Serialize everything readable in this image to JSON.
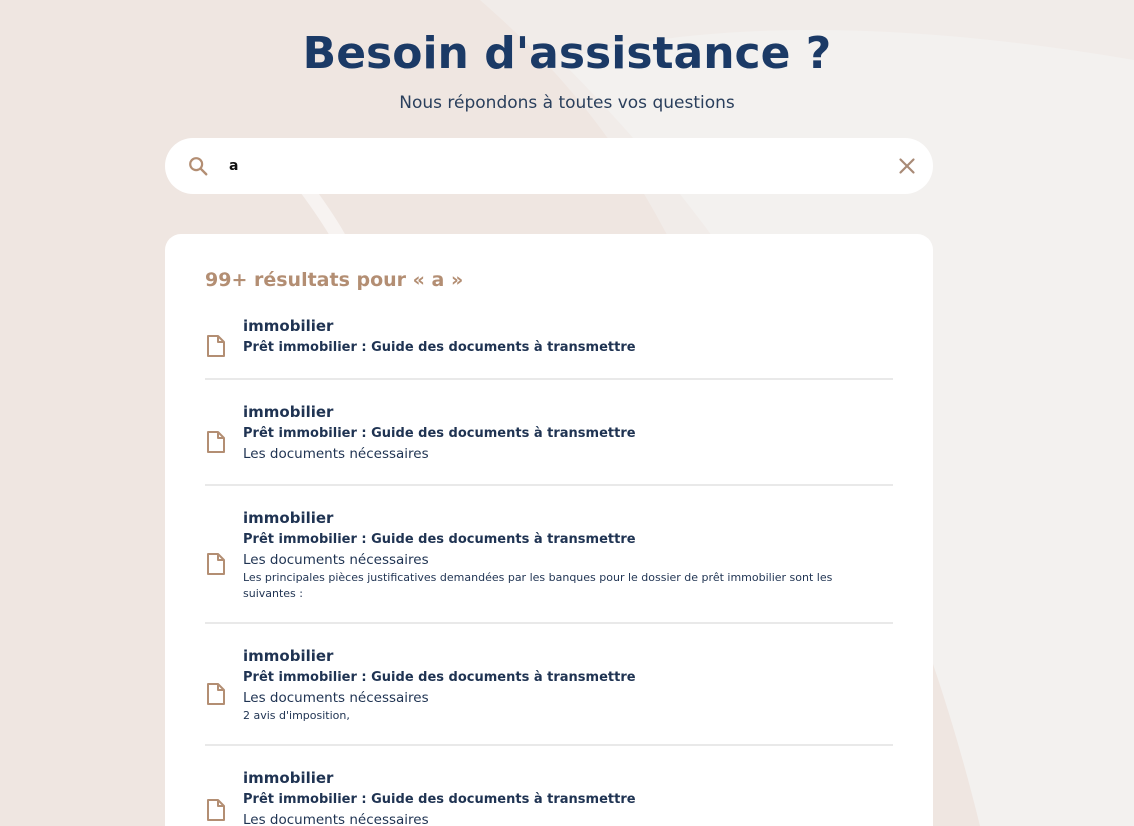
{
  "header": {
    "title": "Besoin d'assistance ?",
    "subtitle": "Nous répondons à toutes vos questions"
  },
  "search": {
    "value": "a",
    "icon": "search-icon",
    "clear_icon": "close-icon"
  },
  "results": {
    "count_label": "99+ résultats pour « a »",
    "items": [
      {
        "category": "immobilier",
        "title": "Prêt immobilier : Guide des documents à transmettre",
        "section": "",
        "snippet": ""
      },
      {
        "category": "immobilier",
        "title": "Prêt immobilier : Guide des documents à transmettre",
        "section": "Les documents nécessaires",
        "snippet": ""
      },
      {
        "category": "immobilier",
        "title": "Prêt immobilier : Guide des documents à transmettre",
        "section": "Les documents nécessaires",
        "snippet": "Les principales pièces justificatives demandées par les banques pour le dossier de prêt immobilier sont les suivantes :"
      },
      {
        "category": "immobilier",
        "title": "Prêt immobilier : Guide des documents à transmettre",
        "section": "Les documents nécessaires",
        "snippet": "2 avis d'imposition,"
      },
      {
        "category": "immobilier",
        "title": "Prêt immobilier : Guide des documents à transmettre",
        "section": "Les documents nécessaires",
        "snippet": ""
      }
    ]
  },
  "colors": {
    "accent": "#b38e73",
    "title": "#1b3a66",
    "text": "#1f3352",
    "background": "#efe6e1"
  }
}
